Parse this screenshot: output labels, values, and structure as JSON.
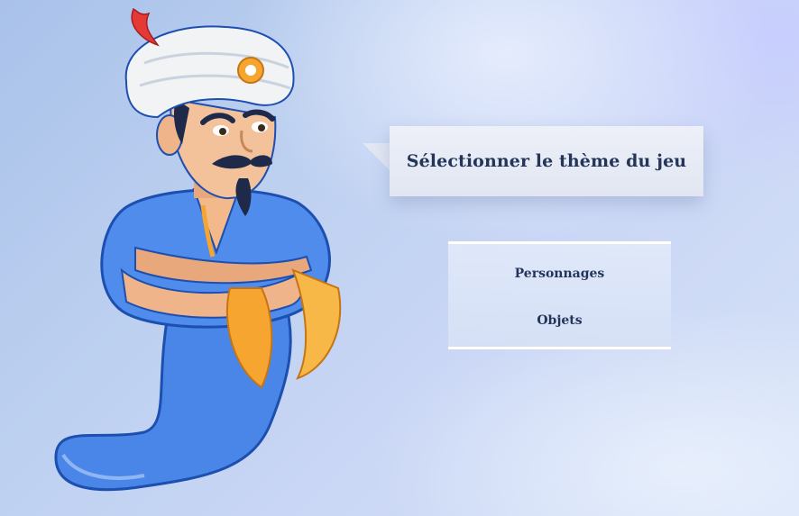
{
  "speech": {
    "text": "Sélectionner le thème du jeu"
  },
  "menu": {
    "items": [
      {
        "label": "Personnages"
      },
      {
        "label": "Objets"
      }
    ]
  },
  "colors": {
    "text": "#24355a",
    "genie_robe": "#4a86e8",
    "turban": "#f1f3f5",
    "feather": "#e53935",
    "cuff": "#f6a531"
  },
  "icons": [
    "genie-character"
  ]
}
